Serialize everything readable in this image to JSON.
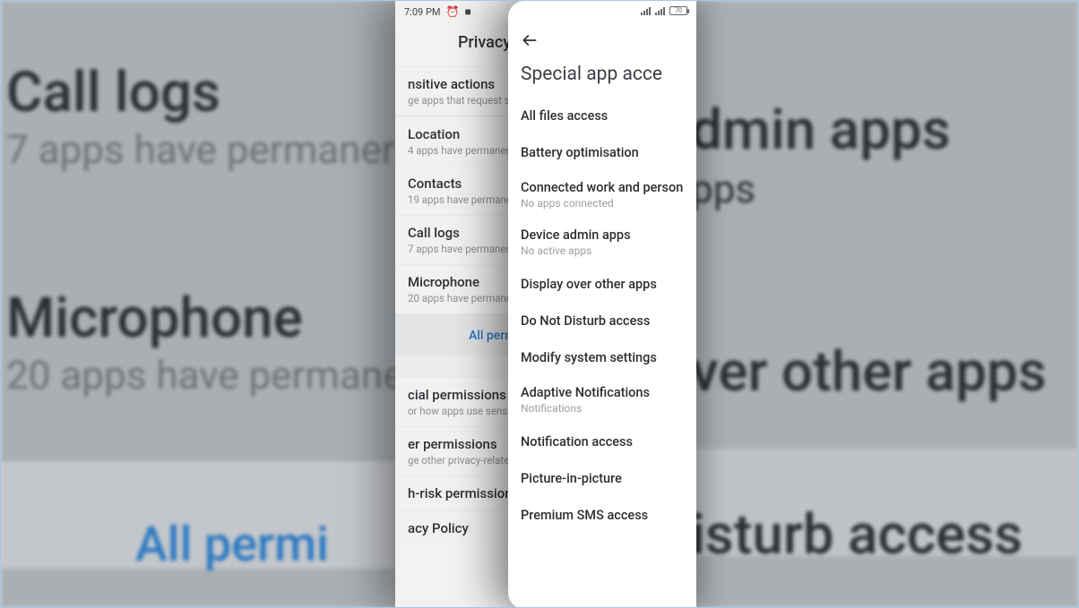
{
  "statusbar_left": {
    "time": "7:09 PM"
  },
  "statusbar_right": {
    "battery_label": "70"
  },
  "left_phone": {
    "title": "Privacy pr",
    "sensitive": {
      "title": "nsitive actions",
      "sub": "ge apps that request s"
    },
    "location": {
      "title": "Location",
      "sub": "4 apps have permaner"
    },
    "contacts": {
      "title": "Contacts",
      "sub": "19 apps have permane"
    },
    "calllogs": {
      "title": "Call logs",
      "sub": "7 apps have permaner"
    },
    "microphone": {
      "title": "Microphone",
      "sub": "20 apps have permane"
    },
    "all_permissions_link": "All permi",
    "special": {
      "title": "cial permissions",
      "sub": "or how apps use sens"
    },
    "other": {
      "title": "er permissions",
      "sub": "ge other privacy-relate"
    },
    "highrisk": {
      "title": "h-risk permissions"
    },
    "policy": {
      "title": "acy Policy"
    }
  },
  "right_phone": {
    "title": "Special app acce",
    "items": [
      {
        "title": "All files access",
        "sub": ""
      },
      {
        "title": "Battery optimisation",
        "sub": ""
      },
      {
        "title": "Connected work and person",
        "sub": "No apps connected"
      },
      {
        "title": "Device admin apps",
        "sub": "No active apps"
      },
      {
        "title": "Display over other apps",
        "sub": ""
      },
      {
        "title": "Do Not Disturb access",
        "sub": ""
      },
      {
        "title": "Modify system settings",
        "sub": ""
      },
      {
        "title": "Adaptive Notifications",
        "sub": "Notifications"
      },
      {
        "title": "Notification access",
        "sub": ""
      },
      {
        "title": "Picture-in-picture",
        "sub": ""
      },
      {
        "title": "Premium SMS access",
        "sub": ""
      }
    ]
  },
  "bg": {
    "calllogs_title": "Call logs",
    "calllogs_sub": "7 apps have permaner",
    "mic_title": "Microphone",
    "mic_sub": "20 apps have permane",
    "all_perm": "All permi",
    "admin_title": "dmin apps",
    "admin_sub": "pps",
    "overother": "ver other apps",
    "disturb": "isturb access"
  }
}
